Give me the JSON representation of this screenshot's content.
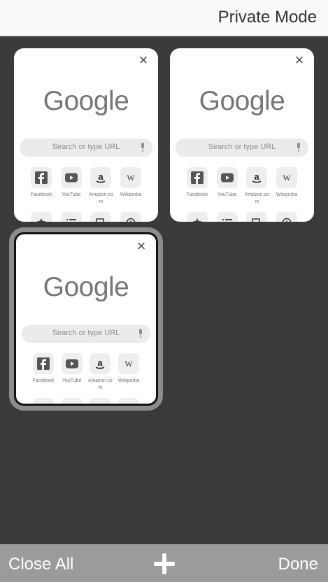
{
  "header": {
    "title": "Private Mode"
  },
  "tabs": [
    {
      "logo": "Google",
      "search_placeholder": "Search or type URL",
      "close_symbol": "×",
      "selected": false,
      "shortcuts": [
        {
          "label": "Facebook",
          "icon": "facebook-icon"
        },
        {
          "label": "YouTube",
          "icon": "youtube-icon"
        },
        {
          "label": "Amazon.co​m",
          "icon": "amazon-icon"
        },
        {
          "label": "Wikipedia",
          "icon": "wikipedia-icon"
        }
      ],
      "second_row_icons": [
        "bookmark-star-icon",
        "reading-list-icon",
        "recent-tabs-icon",
        "history-icon"
      ]
    },
    {
      "logo": "Google",
      "search_placeholder": "Search or type URL",
      "close_symbol": "×",
      "selected": false,
      "shortcuts": [
        {
          "label": "Facebook",
          "icon": "facebook-icon"
        },
        {
          "label": "YouTube",
          "icon": "youtube-icon"
        },
        {
          "label": "Amazon.co​m",
          "icon": "amazon-icon"
        },
        {
          "label": "Wikipedia",
          "icon": "wikipedia-icon"
        }
      ],
      "second_row_icons": [
        "bookmark-star-icon",
        "reading-list-icon",
        "recent-tabs-icon",
        "history-icon"
      ]
    },
    {
      "logo": "Google",
      "search_placeholder": "Search or type URL",
      "close_symbol": "×",
      "selected": true,
      "shortcuts": [
        {
          "label": "Facebook",
          "icon": "facebook-icon"
        },
        {
          "label": "YouTube",
          "icon": "youtube-icon"
        },
        {
          "label": "Amazon.co​m",
          "icon": "amazon-icon"
        },
        {
          "label": "Wikipedia",
          "icon": "wikipedia-icon"
        }
      ],
      "second_row_icons": [
        "bookmark-star-icon",
        "reading-list-icon",
        "recent-tabs-icon",
        "history-icon"
      ]
    }
  ],
  "footer": {
    "close_all_label": "Close All",
    "new_tab_icon": "plus-icon",
    "done_label": "Done"
  }
}
